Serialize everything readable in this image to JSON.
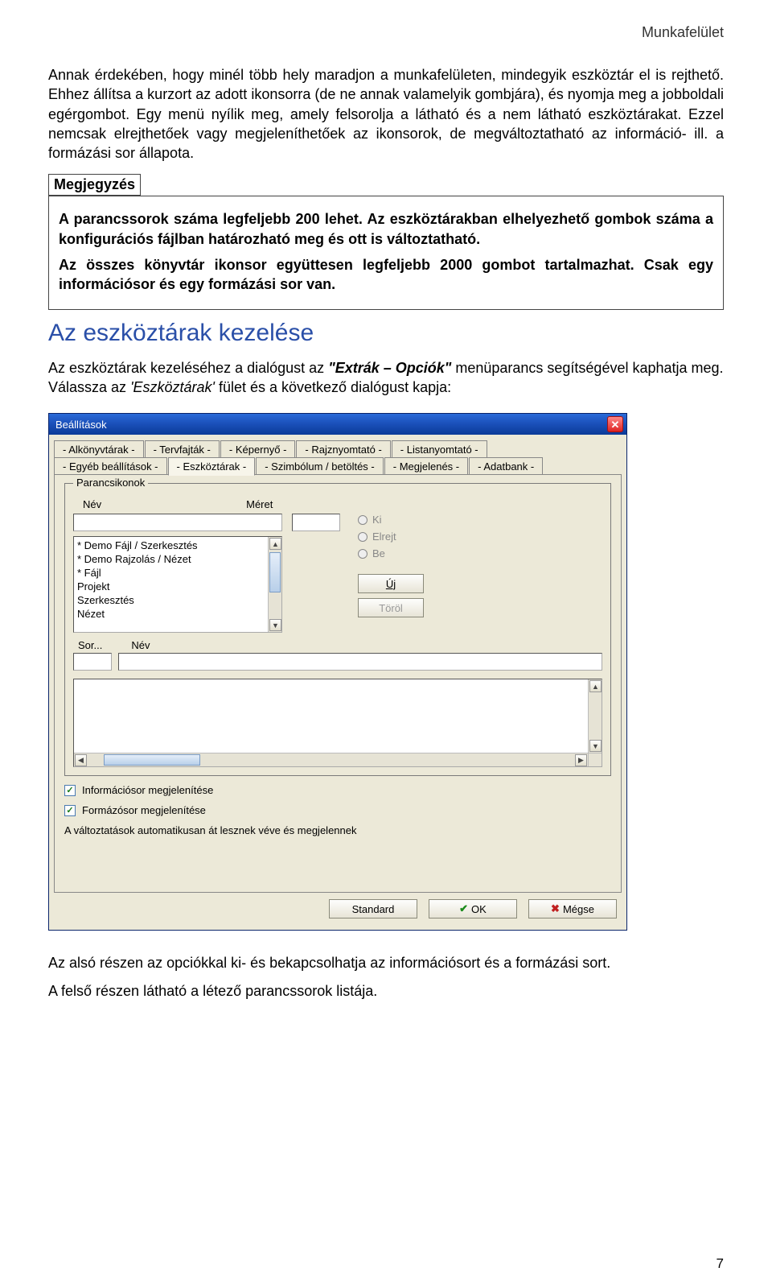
{
  "header": {
    "label": "Munkafelület"
  },
  "para1": "Annak érdekében, hogy minél több hely maradjon a munkafelületen, mindegyik eszköztár el is rejthető. Ehhez állítsa a kurzort az adott ikonsorra (de ne annak valamelyik gombjára), és nyomja meg a jobboldali egérgombot. Egy menü nyílik meg, amely felsorolja a látható és a nem látható eszköztárakat. Ezzel nemcsak elrejthetőek vagy megjeleníthetőek az ikonsorok, de megváltoztatható az információ- ill. a formázási sor állapota.",
  "note": {
    "label": "Megjegyzés",
    "p1": "A parancssorok száma legfeljebb 200 lehet. Az eszköztárakban elhelyezhető gombok száma a konfigurációs fájlban határozható meg és ott is változtatható.",
    "p2": "Az összes könyvtár ikonsor együttesen legfeljebb 2000 gombot tartalmazhat. Csak egy információsor és egy formázási sor van."
  },
  "section_title": "Az eszköztárak kezelése",
  "dialog_intro": {
    "pre": "Az eszköztárak kezeléséhez a dialógust az ",
    "cmd": "\"Extrák – Opciók\"",
    "post": " menüparancs segítségével kaphatja meg."
  },
  "dialog_intro2": {
    "pre": "Válassza az ",
    "tab": "'Eszköztárak'",
    "post": " fület és a következő dialógust kapja:"
  },
  "win": {
    "title": "Beállítások",
    "tabs_row1": [
      "- Alkönyvtárak -",
      "- Tervfajták -",
      "- Képernyő -",
      "- Rajznyomtató -",
      "- Listanyomtató -"
    ],
    "tabs_row2": [
      "- Egyéb beállítások -",
      "- Eszköztárak -",
      "- Szimbólum / betöltés -",
      "- Megjelenés -",
      "- Adatbank -"
    ],
    "active_tab_index": 1,
    "group_legend": "Parancsikonok",
    "labels": {
      "nev": "Név",
      "meret": "Méret"
    },
    "list_items": [
      "* Demo Fájl / Szerkesztés",
      "* Demo Rajzolás / Nézet",
      "* Fájl",
      "  Projekt",
      "  Szerkesztés",
      "  Nézet"
    ],
    "radios": {
      "ki": "Ki",
      "elrejt": "Elrejt",
      "be": "Be"
    },
    "buttons": {
      "uj": "Új",
      "torol": "Töröl"
    },
    "lower_labels": {
      "sor": "Sor...",
      "nev": "Név"
    },
    "checkbox1": "Információsor megjelenítése",
    "checkbox2": "Formázósor megjelenítése",
    "auto_note": "A változtatások automatikusan át lesznek véve és megjelennek",
    "dlg_buttons": {
      "standard": "Standard",
      "ok": "OK",
      "megse": "Mégse"
    }
  },
  "footer": {
    "p1": "Az alsó részen az opciókkal ki- és bekapcsolhatja az információsort és a formázási sort.",
    "p2": "A felső részen látható a létező parancssorok listája."
  },
  "pagenum": "7"
}
